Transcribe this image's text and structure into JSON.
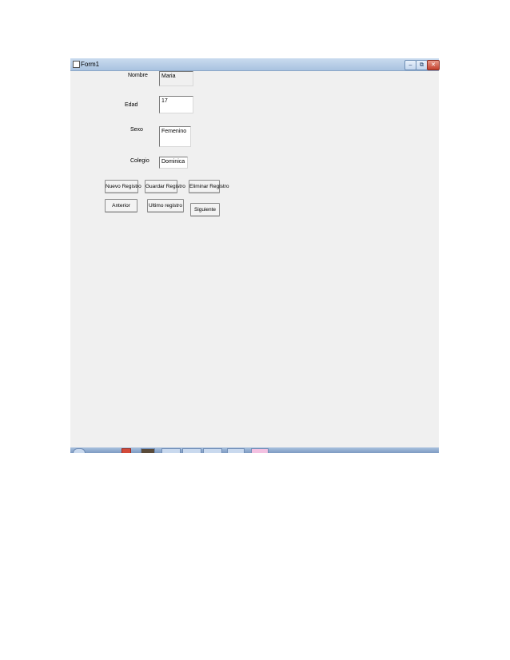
{
  "window": {
    "title": "Form1",
    "minimize": "–",
    "restore": "⧉",
    "close": "✕"
  },
  "form": {
    "nombre_label": "Nombre",
    "nombre_value": "Maria",
    "edad_label": "Edad",
    "edad_value": "17",
    "sexo_label": "Sexo",
    "sexo_value": "Femenino",
    "colegio_label": "Colegio",
    "colegio_value": "Dominica"
  },
  "buttons": {
    "nuevo": "Nuevo Registro",
    "guardar": "Guardar Registro",
    "eliminar": "Eliminar Registro",
    "anterior": "Anterior",
    "ultimo": "Ultimo registro",
    "siguiente": "Siguiente"
  },
  "taskbar": {
    "icons": [
      "start-orb-icon",
      "browser-icon",
      "media-icon",
      "folder-icon",
      "folder-icon",
      "app-icon",
      "window-icon",
      "paint-icon"
    ]
  }
}
